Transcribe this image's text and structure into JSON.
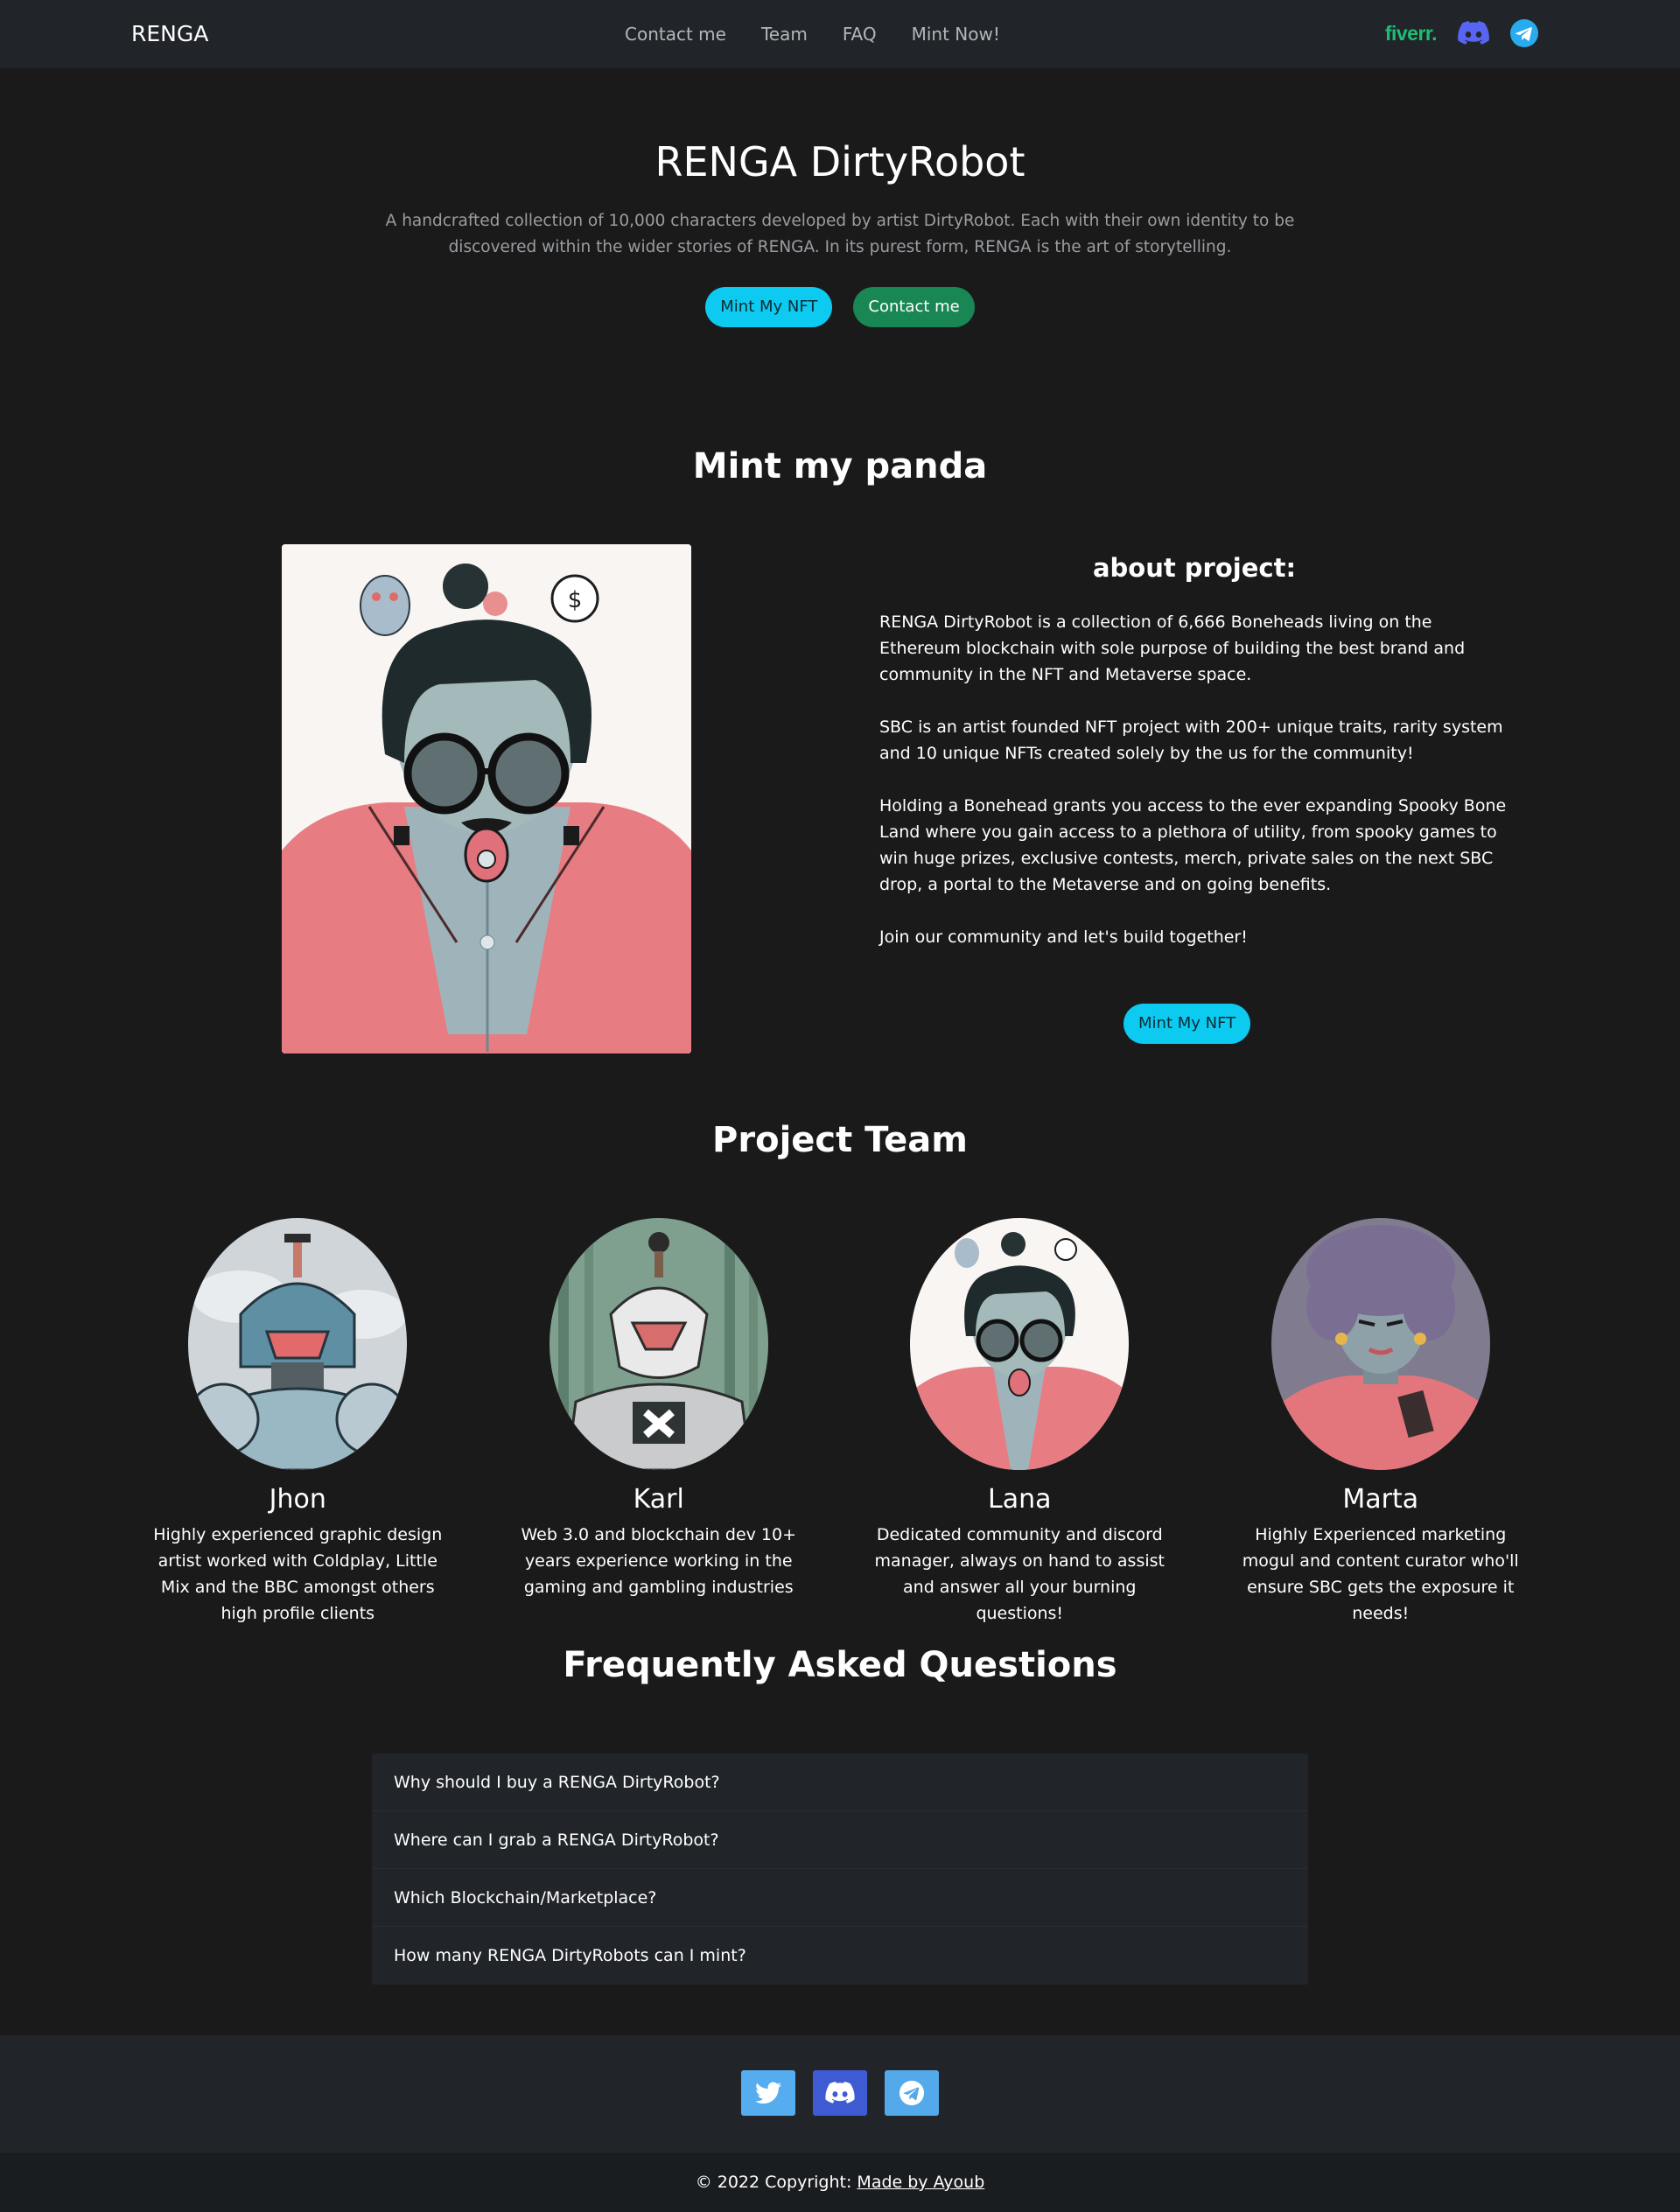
{
  "nav": {
    "brand": "RENGA",
    "links": [
      "Contact me",
      "Team",
      "FAQ",
      "Mint Now!"
    ],
    "fiverr": "fiverr.",
    "icons": [
      "fiverr-logo",
      "discord-icon",
      "telegram-icon"
    ]
  },
  "hero": {
    "title": "RENGA DirtyRobot",
    "description": "A handcrafted collection of 10,000 characters developed by artist DirtyRobot. Each with their own identity to be discovered within the wider stories of RENGA. In its purest form, RENGA is the art of storytelling.",
    "mint_button": "Mint My NFT",
    "contact_button": "Contact me"
  },
  "mint": {
    "title": "Mint my panda",
    "about_title": "about project:",
    "paragraphs": [
      "RENGA DirtyRobot is a collection of 6,666 Boneheads living on the Ethereum blockchain with sole purpose of building the best brand and community in the NFT and Metaverse space.",
      "SBC is an artist founded NFT project with 200+ unique traits, rarity system and 10 unique NFTs created solely by the us for the community!",
      "Holding a Bonehead grants you access to the ever expanding Spooky Bone Land where you gain access to a plethora of utility, from spooky games to win huge prizes, exclusive contests, merch, private sales on the next SBC drop, a portal to the Metaverse and on going benefits.",
      "Join our community and let's build together!"
    ],
    "mint_button": "Mint My NFT"
  },
  "team": {
    "title": "Project Team",
    "members": [
      {
        "name": "Jhon",
        "bio": "Highly experienced graphic design artist worked with Coldplay, Little Mix and the BBC amongst others high profile clients"
      },
      {
        "name": "Karl",
        "bio": "Web 3.0 and blockchain dev 10+ years experience working in the gaming and gambling industries"
      },
      {
        "name": "Lana",
        "bio": "Dedicated community and discord manager, always on hand to assist and answer all your burning questions!"
      },
      {
        "name": "Marta",
        "bio": "Highly Experienced marketing mogul and content curator who'll ensure SBC gets the exposure it needs!"
      }
    ]
  },
  "faq": {
    "title": "Frequently Asked Questions",
    "items": [
      "Why should I buy a RENGA DirtyRobot?",
      "Where can I grab a RENGA DirtyRobot?",
      "Which Blockchain/Marketplace?",
      "How many RENGA DirtyRobots can I mint?"
    ]
  },
  "footer": {
    "social": [
      "twitter-icon",
      "discord-icon",
      "telegram-icon"
    ],
    "copyright": "© 2022 Copyright: ",
    "credit": "Made by Ayoub"
  },
  "colors": {
    "background": "#1a1a1b",
    "navbar": "#212529",
    "cyan_button": "#0dcaf0",
    "green_button": "#198754",
    "fiverr": "#1dbf73",
    "discord": "#5865f2",
    "telegram": "#2aabee"
  }
}
